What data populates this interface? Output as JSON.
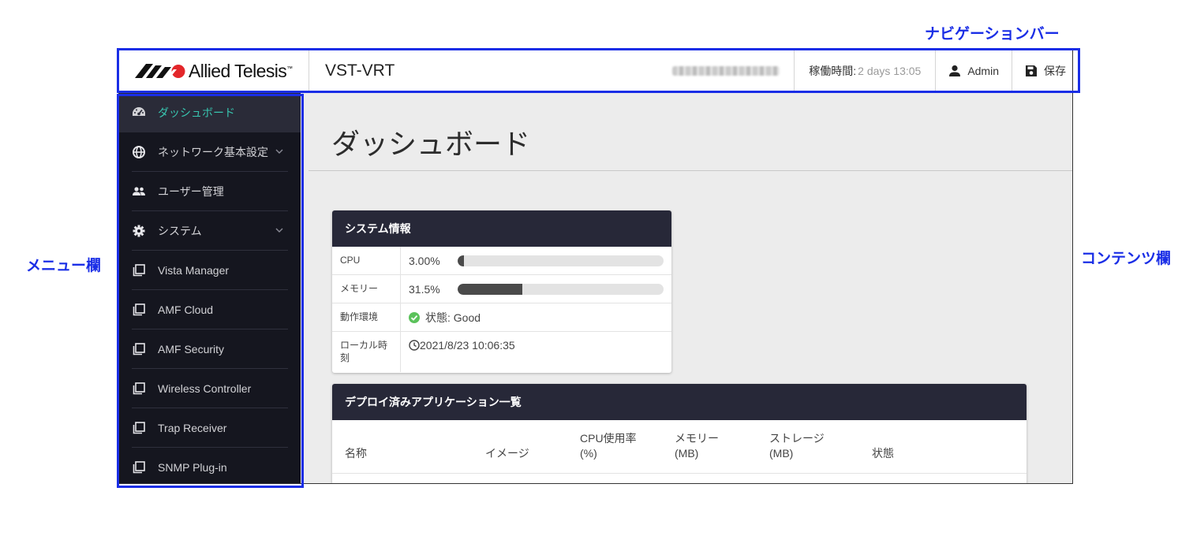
{
  "annotations": {
    "navbar": "ナビゲーションバー",
    "menu": "メニュー欄",
    "content": "コンテンツ欄"
  },
  "navbar": {
    "brand": "Allied Telesis",
    "device": "VST-VRT",
    "uptime_label": "稼働時間:",
    "uptime_value": "2 days 13:05",
    "user": "Admin",
    "save": "保存"
  },
  "sidebar": {
    "items": [
      {
        "label": "ダッシュボード",
        "icon": "speedometer-icon",
        "active": true
      },
      {
        "label": "ネットワーク基本設定",
        "icon": "globe-icon",
        "expandable": true
      },
      {
        "label": "ユーザー管理",
        "icon": "users-icon"
      },
      {
        "label": "システム",
        "icon": "gear-icon",
        "expandable": true
      },
      {
        "label": "Vista Manager",
        "icon": "app-window-icon"
      },
      {
        "label": "AMF Cloud",
        "icon": "app-window-icon"
      },
      {
        "label": "AMF Security",
        "icon": "app-window-icon"
      },
      {
        "label": "Wireless Controller",
        "icon": "app-window-icon"
      },
      {
        "label": "Trap Receiver",
        "icon": "app-window-icon"
      },
      {
        "label": "SNMP Plug-in",
        "icon": "app-window-icon"
      }
    ]
  },
  "main": {
    "title": "ダッシュボード",
    "system_info": {
      "header": "システム情報",
      "cpu_label": "CPU",
      "cpu_value": "3.00%",
      "cpu_fraction": 0.03,
      "memory_label": "メモリー",
      "memory_value": "31.5%",
      "memory_fraction": 0.315,
      "env_label": "動作環境",
      "env_value": "状態: Good",
      "time_label": "ローカル時刻",
      "time_value": "2021/8/23 10:06:35"
    },
    "apps": {
      "header": "デプロイ済みアプリケーション一覧",
      "columns": [
        "名称",
        "イメージ",
        "CPU使用率\n(%)",
        "メモリー\n(MB)",
        "ストレージ\n(MB)",
        "状態"
      ]
    }
  },
  "colors": {
    "annotation": "#1a2ee6",
    "sidebar_bg": "#15161f",
    "active_text": "#38c6b0",
    "card_header": "#272838",
    "status_good": "#5bc25b"
  }
}
